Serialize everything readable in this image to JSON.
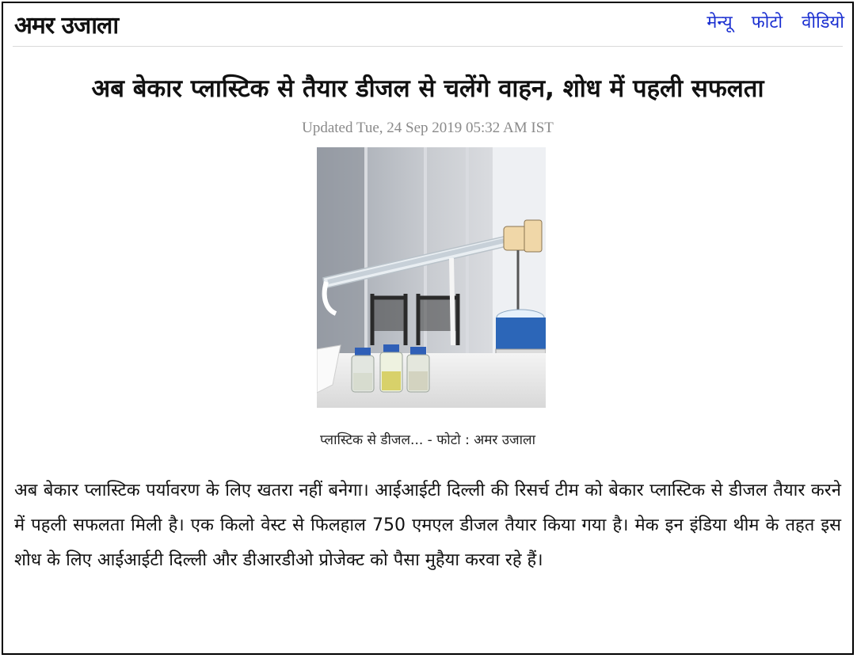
{
  "header": {
    "logo_text": "अमर उजाला",
    "nav": [
      {
        "label": "मेन्यू"
      },
      {
        "label": "फोटो"
      },
      {
        "label": "वीडियो"
      }
    ]
  },
  "article": {
    "headline": "अब बेकार प्लास्टिक से तैयार डीजल से चलेंगे वाहन, शोध में पहली सफलता",
    "dateline": "Updated Tue, 24 Sep 2019 05:32 AM IST",
    "image": {
      "caption": "प्लास्टिक से डीजल... - फोटो : अमर उजाला"
    },
    "body": "अब बेकार प्लास्टिक पर्यावरण के लिए खतरा नहीं बनेगा। आईआईटी दिल्ली की रिसर्च टीम को बेकार प्लास्टिक से डीजल तैयार करने में पहली सफलता मिली है। एक किलो वेस्ट से फिलहाल 750 एमएल डीजल तैयार किया गया है। मेक इन इंडिया थीम के तहत इस शोध के लिए आईआईटी दिल्ली और डीआरडीओ प्रोजेक्ट को पैसा मुहैया करवा रहे हैं।"
  }
}
